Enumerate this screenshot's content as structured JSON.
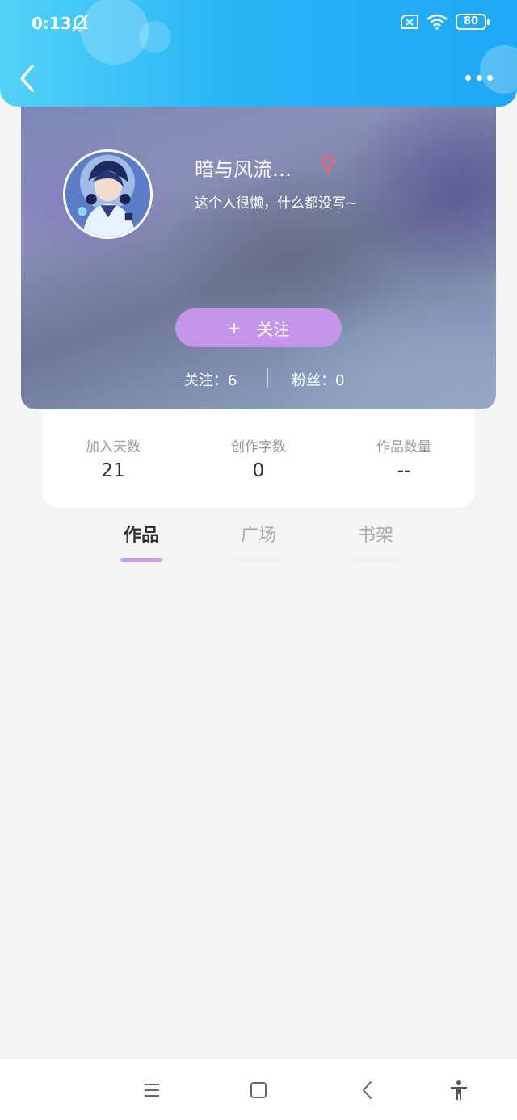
{
  "status_bar": {
    "time": "0:13",
    "battery": "80",
    "icons": [
      "bell-off-icon",
      "sim-off-icon",
      "wifi-icon",
      "battery-icon"
    ]
  },
  "header": {
    "back_icon": "chevron-left-icon",
    "more_icon": "more-dots-icon",
    "colors": {
      "gradient_start": "#52d2f7",
      "gradient_end": "#1ea8f5"
    }
  },
  "profile": {
    "name": "暗与风流…",
    "gender_symbol": "♀",
    "bio": "这个人很懒，什么都没写~",
    "follow_plus": "+",
    "follow_label": "关注",
    "following_text": "关注：6",
    "fans_text": "粉丝：0",
    "colors": {
      "follow_button": "#c495e8",
      "gender": "#e9637a"
    }
  },
  "stats": [
    {
      "label": "加入天数",
      "value": "21"
    },
    {
      "label": "创作字数",
      "value": "0"
    },
    {
      "label": "作品数量",
      "value": "--"
    }
  ],
  "tabs": [
    {
      "label": "作品",
      "active": true
    },
    {
      "label": "广场",
      "active": false
    },
    {
      "label": "书架",
      "active": false
    }
  ],
  "nav_bar": {
    "icons": [
      "menu-icon",
      "home-icon",
      "back-icon",
      "accessibility-icon"
    ]
  }
}
